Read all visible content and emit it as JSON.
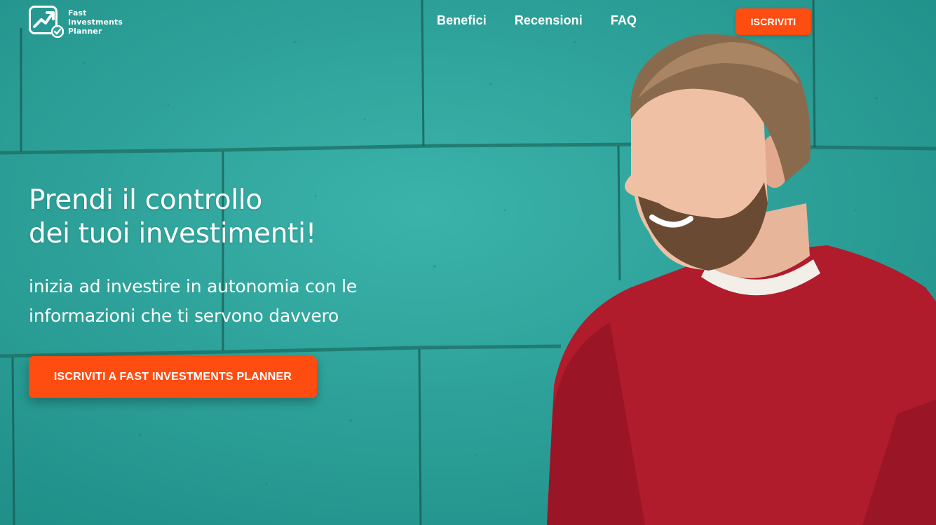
{
  "brand": {
    "name_lines": [
      "Fast",
      "Investments",
      "Planner"
    ]
  },
  "nav": {
    "links": [
      "Benefici",
      "Recensioni",
      "FAQ"
    ],
    "cta_label": "ISCRIVITI"
  },
  "hero": {
    "headline_lines": [
      "Prendi il controllo",
      "dei tuoi investimenti!"
    ],
    "subheadline_lines": [
      "inizia ad investire in autonomia con le",
      "informazioni che ti servono davvero"
    ],
    "cta_label": "ISCRIVITI A FAST INVESTMENTS PLANNER",
    "background_image": "man-in-red-sweater-in-front-of-teal-brick-wall"
  },
  "colors": {
    "accent": "#ff4d12",
    "wall": "#2aa39b",
    "text": "#ffffff"
  }
}
